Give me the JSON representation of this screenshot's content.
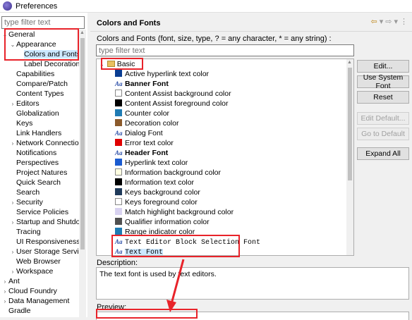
{
  "window": {
    "title": "Preferences"
  },
  "left": {
    "filter_placeholder": "type filter text",
    "tree": [
      {
        "label": "General",
        "level": 0,
        "twisty": "open"
      },
      {
        "label": "Appearance",
        "level": 1,
        "twisty": "open"
      },
      {
        "label": "Colors and Fonts",
        "level": 2,
        "twisty": "",
        "selected": true
      },
      {
        "label": "Label Decorations",
        "level": 2,
        "twisty": ""
      },
      {
        "label": "Capabilities",
        "level": 1,
        "twisty": ""
      },
      {
        "label": "Compare/Patch",
        "level": 1,
        "twisty": ""
      },
      {
        "label": "Content Types",
        "level": 1,
        "twisty": ""
      },
      {
        "label": "Editors",
        "level": 1,
        "twisty": "closed"
      },
      {
        "label": "Globalization",
        "level": 1,
        "twisty": ""
      },
      {
        "label": "Keys",
        "level": 1,
        "twisty": ""
      },
      {
        "label": "Link Handlers",
        "level": 1,
        "twisty": ""
      },
      {
        "label": "Network Connections",
        "level": 1,
        "twisty": "closed"
      },
      {
        "label": "Notifications",
        "level": 1,
        "twisty": ""
      },
      {
        "label": "Perspectives",
        "level": 1,
        "twisty": ""
      },
      {
        "label": "Project Natures",
        "level": 1,
        "twisty": ""
      },
      {
        "label": "Quick Search",
        "level": 1,
        "twisty": ""
      },
      {
        "label": "Search",
        "level": 1,
        "twisty": ""
      },
      {
        "label": "Security",
        "level": 1,
        "twisty": "closed"
      },
      {
        "label": "Service Policies",
        "level": 1,
        "twisty": ""
      },
      {
        "label": "Startup and Shutdown",
        "level": 1,
        "twisty": "closed"
      },
      {
        "label": "Tracing",
        "level": 1,
        "twisty": ""
      },
      {
        "label": "UI Responsiveness",
        "level": 1,
        "twisty": ""
      },
      {
        "label": "User Storage Service",
        "level": 1,
        "twisty": "closed"
      },
      {
        "label": "Web Browser",
        "level": 1,
        "twisty": ""
      },
      {
        "label": "Workspace",
        "level": 1,
        "twisty": "closed"
      },
      {
        "label": "Ant",
        "level": 0,
        "twisty": "closed"
      },
      {
        "label": "Cloud Foundry",
        "level": 0,
        "twisty": "closed"
      },
      {
        "label": "Data Management",
        "level": 0,
        "twisty": "closed"
      },
      {
        "label": "Gradle",
        "level": 0,
        "twisty": ""
      }
    ]
  },
  "right": {
    "title": "Colors and Fonts",
    "description": "Colors and Fonts (font, size, type, ? = any character, * = any string) :",
    "filter_placeholder": "type filter text",
    "group_label": "Basic",
    "items": [
      {
        "label": "Active hyperlink text color",
        "kind": "color",
        "color": "#0a3d91"
      },
      {
        "label": "Banner Font",
        "kind": "font",
        "bold": true
      },
      {
        "label": "Content Assist background color",
        "kind": "color",
        "color": "#ffffff"
      },
      {
        "label": "Content Assist foreground color",
        "kind": "color",
        "color": "#000000"
      },
      {
        "label": "Counter color",
        "kind": "color",
        "color": "#1f7bb3"
      },
      {
        "label": "Decoration color",
        "kind": "color",
        "color": "#8b5a2b"
      },
      {
        "label": "Dialog Font",
        "kind": "font"
      },
      {
        "label": "Error text color",
        "kind": "color",
        "color": "#e00000"
      },
      {
        "label": "Header Font",
        "kind": "font",
        "bold": true
      },
      {
        "label": "Hyperlink text color",
        "kind": "color",
        "color": "#1a5bd0"
      },
      {
        "label": "Information background color",
        "kind": "color",
        "color": "#ffffe1"
      },
      {
        "label": "Information text color",
        "kind": "color",
        "color": "#000000"
      },
      {
        "label": "Keys background color",
        "kind": "color",
        "color": "#1f3a5a"
      },
      {
        "label": "Keys foreground color",
        "kind": "color",
        "color": "#ffffff"
      },
      {
        "label": "Match highlight background color",
        "kind": "color",
        "color": "#d8d2f0"
      },
      {
        "label": "Qualifier information color",
        "kind": "color",
        "color": "#505050"
      },
      {
        "label": "Range indicator color",
        "kind": "color",
        "color": "#1f7bb3"
      },
      {
        "label": "Text Editor Block Selection Font",
        "kind": "font",
        "mono": true
      },
      {
        "label": "Text Font",
        "kind": "font",
        "mono": true,
        "selected": true
      }
    ],
    "buttons": {
      "edit": "Edit...",
      "use_system_font": "Use System Font",
      "reset": "Reset",
      "edit_default": "Edit Default...",
      "go_to_default": "Go to Default",
      "expand_all": "Expand All"
    },
    "description_label": "Description:",
    "description_text": "The text font is used by text editors.",
    "preview_label": "Preview:"
  }
}
